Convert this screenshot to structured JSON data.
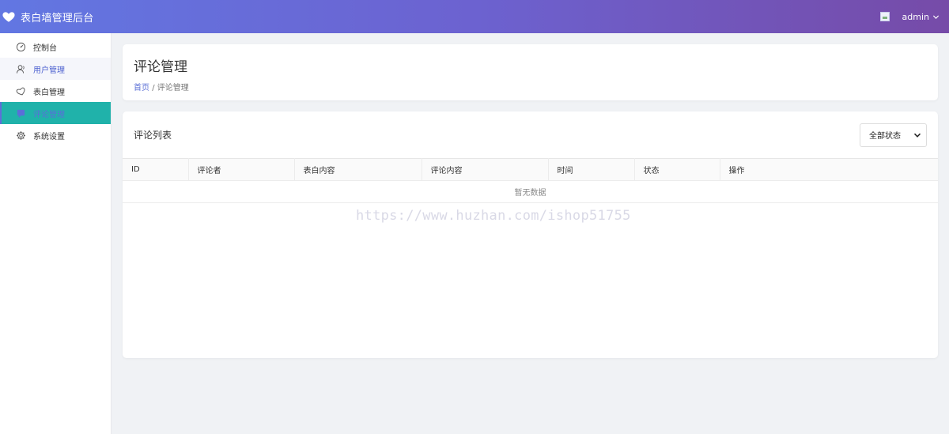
{
  "header": {
    "brand_title": "表白墙管理后台",
    "user_name": "admin"
  },
  "sidebar": {
    "items": [
      {
        "label": "控制台",
        "icon": "dashboard-icon"
      },
      {
        "label": "用户管理",
        "icon": "user-icon"
      },
      {
        "label": "表白管理",
        "icon": "heart-outline-icon"
      },
      {
        "label": "评论管理",
        "icon": "comment-icon"
      },
      {
        "label": "系统设置",
        "icon": "gear-icon"
      }
    ],
    "active_index": 3
  },
  "page": {
    "title": "评论管理",
    "breadcrumb_home": "首页",
    "breadcrumb_sep": "/",
    "breadcrumb_current": "评论管理"
  },
  "list": {
    "title": "评论列表",
    "status_filter": "全部状态",
    "columns": [
      "ID",
      "评论者",
      "表白内容",
      "评论内容",
      "时间",
      "状态",
      "操作"
    ],
    "empty_text": "暂无数据"
  },
  "watermark": "https://www.huzhan.com/ishop51755",
  "colors": {
    "header_gradient_start": "#6277e2",
    "header_gradient_end": "#764ba8",
    "active_nav_bg": "#20b2aa",
    "link_blue": "#5b6fd6"
  }
}
